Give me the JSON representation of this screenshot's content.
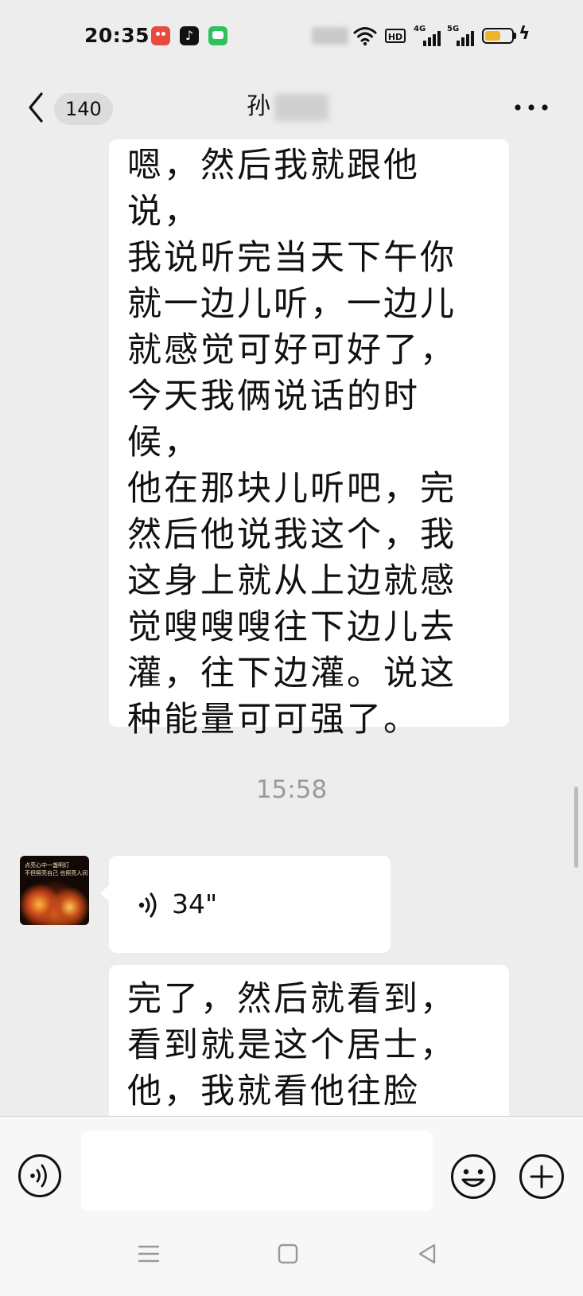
{
  "status_bar": {
    "time": "20:35",
    "hd_label": "HD",
    "network_1": "4G",
    "network_2": "5G",
    "battery_level": 0.6,
    "battery_color": "#f0b429",
    "charging": true,
    "charge_glyph": "ϟ",
    "notification_icons": [
      "red-app-icon",
      "tiktok-icon",
      "green-message-icon"
    ],
    "tiktok_glyph": "♪"
  },
  "header": {
    "unread_count": "140",
    "contact_name_visible": "孙"
  },
  "messages": [
    {
      "type": "text",
      "lines": [
        "嗯，然后我就跟他说，",
        "我说听完当天下午你",
        "就一边儿听，一边儿",
        "就感觉可好可好了，",
        "今天我俩说话的时候，",
        "他在那块儿听吧，完",
        "然后他说我这个，我",
        "这身上就从上边就感",
        "觉嗖嗖嗖往下边儿去",
        "灌，往下边灌。说这",
        "种能量可可强了。"
      ]
    },
    {
      "type": "timestamp",
      "text": "15:58"
    },
    {
      "type": "voice",
      "duration": "34\"",
      "avatar_caption": [
        "点亮心中一盏明灯",
        "不但照亮自己 也照亮人间"
      ]
    },
    {
      "type": "text",
      "lines": [
        "完了，然后就看到，",
        "看到就是这个居士，",
        "他，我就看他往脸"
      ]
    }
  ],
  "input_bar": {
    "value": "",
    "placeholder": ""
  },
  "colors": {
    "background": "#ededed",
    "bubble": "#ffffff",
    "timestamp": "#9a9a9a",
    "input_bar": "#f7f7f7"
  }
}
